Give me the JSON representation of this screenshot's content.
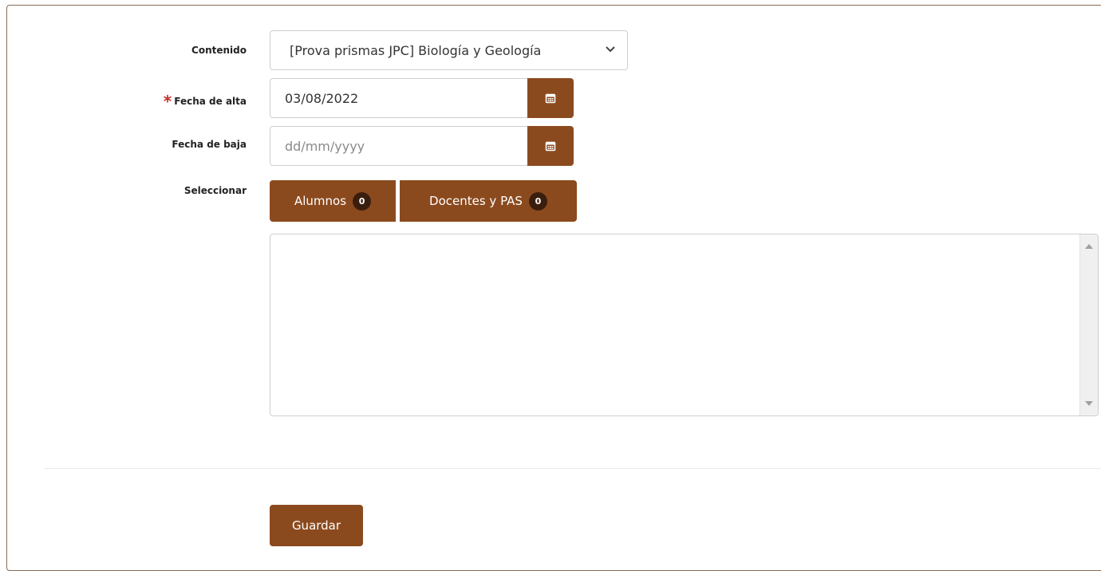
{
  "form": {
    "contenido": {
      "label": "Contenido",
      "selected": "[Prova prismas JPC] Biología y Geología"
    },
    "fecha_alta": {
      "required_mark": "*",
      "label": "Fecha de alta",
      "value": "03/08/2022"
    },
    "fecha_baja": {
      "label": "Fecha de baja",
      "placeholder": "dd/mm/yyyy"
    },
    "seleccionar": {
      "label": "Seleccionar",
      "tabs": [
        {
          "label": "Alumnos",
          "count": "0"
        },
        {
          "label": "Docentes y PAS",
          "count": "0"
        }
      ]
    },
    "save_label": "Guardar"
  },
  "colors": {
    "accent": "#8b4a1e",
    "badge": "#3a1e0d",
    "required": "#c0302a",
    "border": "#8b6a52"
  },
  "icons": {
    "calendar": "calendar-icon",
    "dropdown": "chevron-down-icon"
  }
}
